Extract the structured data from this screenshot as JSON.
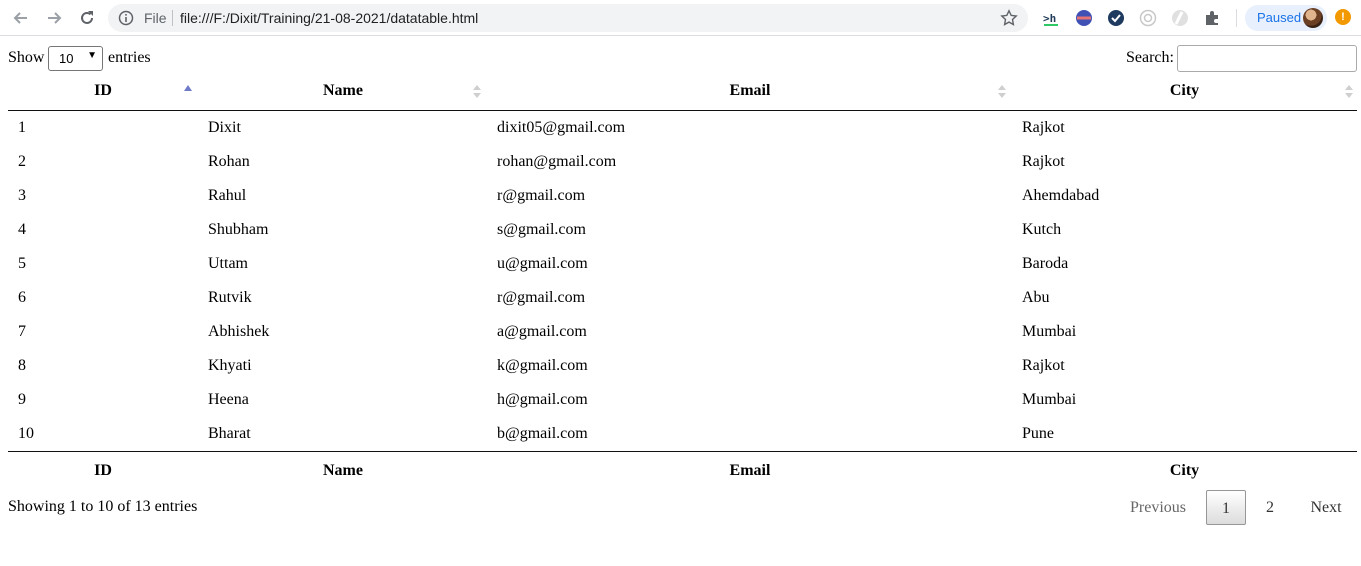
{
  "browser": {
    "file_label": "File",
    "url": "file:///F:/Dixit/Training/21-08-2021/datatable.html",
    "profile_label": "Paused",
    "update_badge": "!",
    "icons": [
      "back-arrow-icon",
      "forward-arrow-icon",
      "reload-icon",
      "info-icon",
      "star-icon",
      "hackerrank-extension-icon",
      "extension-icon",
      "checkmark-extension-icon",
      "extension-icon",
      "extension-icon",
      "puzzle-icon"
    ]
  },
  "length": {
    "show_label": "Show",
    "value": "10",
    "entries_label": "entries"
  },
  "search": {
    "label": "Search:",
    "value": ""
  },
  "table": {
    "columns": [
      "ID",
      "Name",
      "Email",
      "City"
    ],
    "sorted_column": "ID",
    "sort_direction": "ascending",
    "rows": [
      [
        "1",
        "Dixit",
        "dixit05@gmail.com",
        "Rajkot"
      ],
      [
        "2",
        "Rohan",
        "rohan@gmail.com",
        "Rajkot"
      ],
      [
        "3",
        "Rahul",
        "r@gmail.com",
        "Ahemdabad"
      ],
      [
        "4",
        "Shubham",
        "s@gmail.com",
        "Kutch"
      ],
      [
        "5",
        "Uttam",
        "u@gmail.com",
        "Baroda"
      ],
      [
        "6",
        "Rutvik",
        "r@gmail.com",
        "Abu"
      ],
      [
        "7",
        "Abhishek",
        "a@gmail.com",
        "Mumbai"
      ],
      [
        "8",
        "Khyati",
        "k@gmail.com",
        "Rajkot"
      ],
      [
        "9",
        "Heena",
        "h@gmail.com",
        "Mumbai"
      ],
      [
        "10",
        "Bharat",
        "b@gmail.com",
        "Pune"
      ]
    ]
  },
  "info": "Showing 1 to 10 of 13 entries",
  "pagination": {
    "previous": "Previous",
    "pages": [
      "1",
      "2"
    ],
    "current": "1",
    "next": "Next"
  },
  "colors": {
    "sort_active": "#6f7bc8",
    "sort_inactive": "#cfcfcf",
    "profile_accent": "#1a73e8",
    "update_badge": "#f29900"
  }
}
